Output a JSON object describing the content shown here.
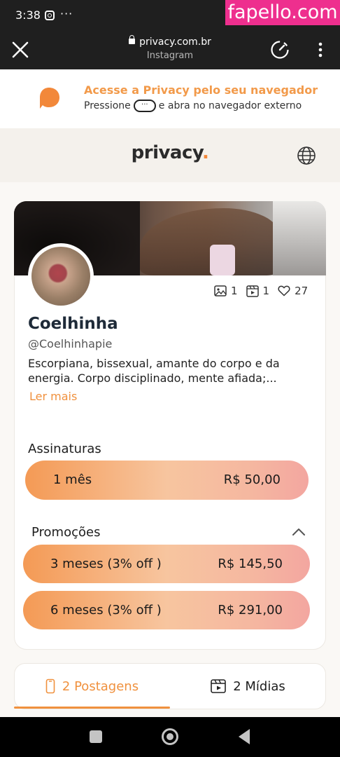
{
  "status_bar": {
    "time": "3:38",
    "overflow": "···",
    "icons": [
      "instagram-icon"
    ]
  },
  "watermark": "fapello.com",
  "browser": {
    "domain": "privacy.com.br",
    "subtitle": "Instagram",
    "icons": [
      "close-icon",
      "lock-icon",
      "speedometer-icon",
      "more-vert-icon"
    ]
  },
  "banner": {
    "title": "Acesse a Privacy pelo seu navegador",
    "text_before": "Pressione",
    "pill_glyph": "···",
    "text_after": "e abra no navegador externo",
    "accent": "#f29a4a"
  },
  "site_header": {
    "brand": "privacy",
    "brand_dot": ".",
    "icons": [
      "globe-icon"
    ]
  },
  "profile": {
    "name": "Coelhinha",
    "handle": "@Coelhinhapie",
    "bio": "Escorpiana, bissexual, amante do corpo e da energia. Corpo disciplinado, mente afiada;...",
    "read_more": "Ler mais",
    "stats": {
      "photos": "1",
      "videos": "1",
      "likes": "27"
    }
  },
  "subscriptions": {
    "title": "Assinaturas",
    "plans": [
      {
        "label": "1 mês",
        "price": "R$ 50,00"
      }
    ]
  },
  "promotions": {
    "title": "Promoções",
    "plans": [
      {
        "label": "3 meses (3% off )",
        "price": "R$ 145,50"
      },
      {
        "label": "6 meses (3% off )",
        "price": "R$ 291,00"
      }
    ]
  },
  "tabs": [
    {
      "label": "2 Postagens",
      "icon": "phone-icon",
      "active": true
    },
    {
      "label": "2 Mídias",
      "icon": "film-icon",
      "active": false
    }
  ],
  "colors": {
    "accent_orange": "#f0913e",
    "brand_text": "#2b2b2b",
    "watermark_bg": "#ee2f8e"
  }
}
